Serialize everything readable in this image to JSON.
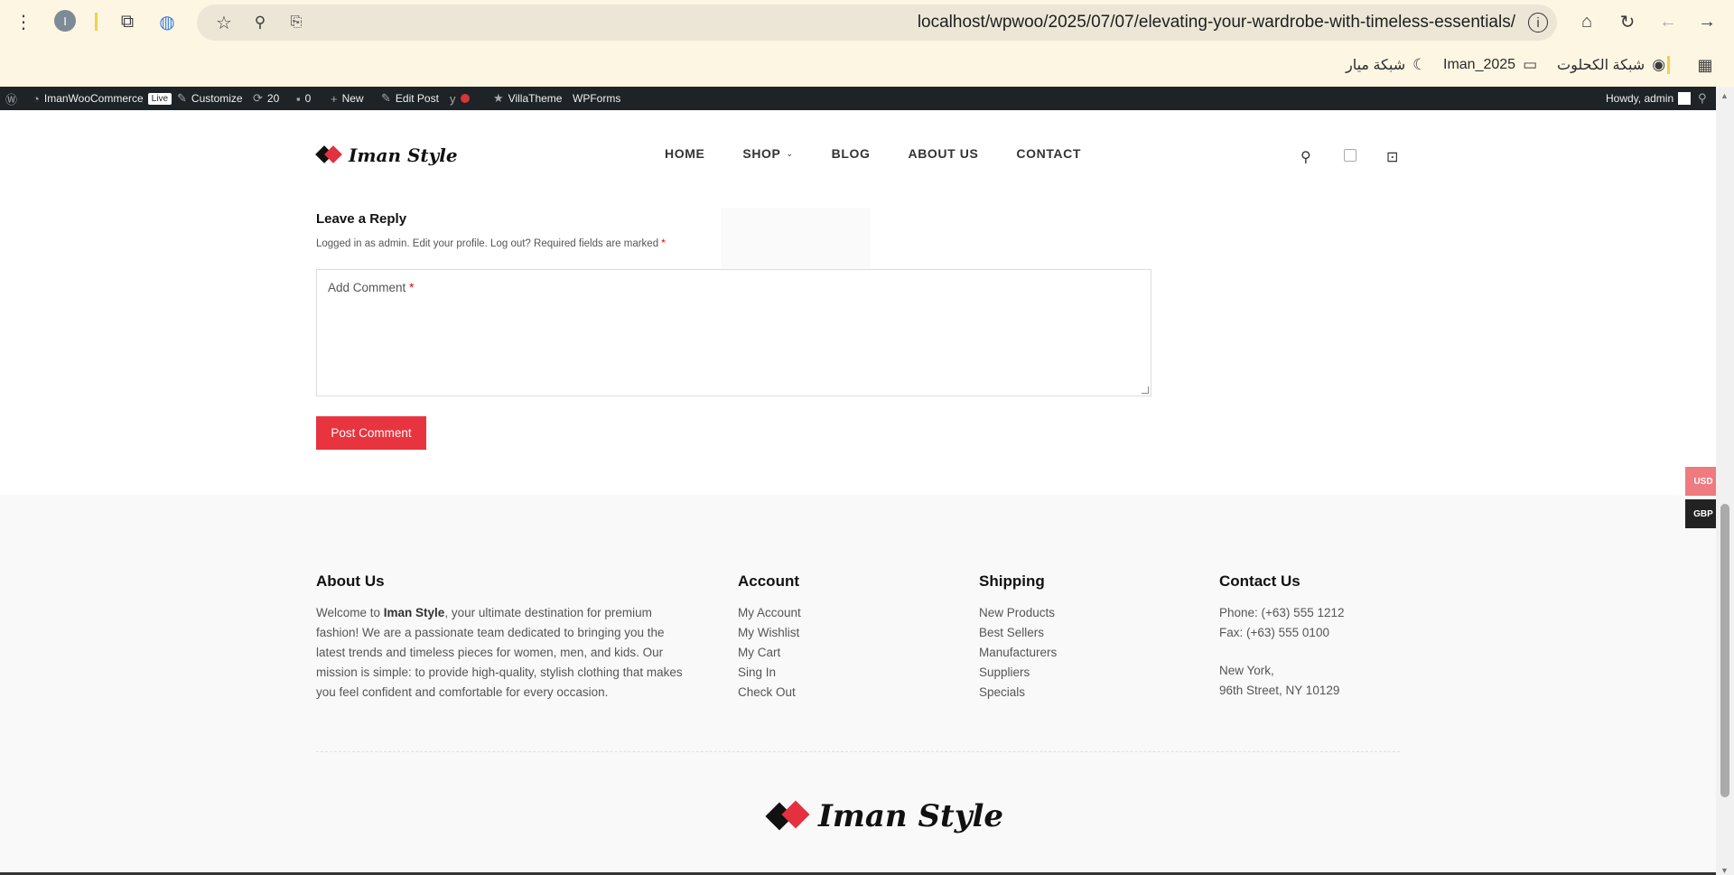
{
  "browser": {
    "profile_initial": "I",
    "url": "localhost/wpwoo/2025/07/07/elevating-your-wardrobe-with-timeless-essentials/",
    "bookmarks": [
      "شبكة الكحلوت",
      "Iman_2025",
      "شبكة ميار"
    ]
  },
  "adminbar": {
    "site": "ImanWooCommerce",
    "live": "Live",
    "customize": "Customize",
    "updates": "20",
    "comments": "0",
    "new": "New",
    "edit_post": "Edit Post",
    "villatheme": "VillaTheme",
    "wpforms": "WPForms",
    "howdy": "Howdy, admin"
  },
  "header": {
    "logo": "Iman Style",
    "nav": [
      "HOME",
      "SHOP",
      "BLOG",
      "ABOUT US",
      "CONTACT"
    ]
  },
  "reply": {
    "title": "Leave a Reply",
    "logged_in": "Logged in as admin. Edit your profile. Log out? Required fields are marked",
    "required_mark": "*",
    "comment_placeholder": "Add Comment",
    "post_button": "Post Comment"
  },
  "currency": {
    "usd": "USD",
    "gbp": "GBP"
  },
  "footer": {
    "about": {
      "title": "About Us",
      "text_before": "Welcome to ",
      "brand": "Iman Style",
      "text_after": ", your ultimate destination for premium fashion! We are a passionate team dedicated to bringing you the latest trends and timeless pieces for women, men, and kids. Our mission is simple: to provide high-quality, stylish clothing that makes you feel confident and comfortable for every occasion."
    },
    "account": {
      "title": "Account",
      "links": [
        "My Account",
        "My Wishlist",
        "My Cart",
        "Sing In",
        "Check Out"
      ]
    },
    "shipping": {
      "title": "Shipping",
      "links": [
        "New Products",
        "Best Sellers",
        "Manufacturers",
        "Suppliers",
        "Specials"
      ]
    },
    "contact": {
      "title": "Contact Us",
      "phone": "Phone: (+63) 555 1212",
      "fax": "Fax: (+63) 555 0100",
      "city": "New York,",
      "street": "96th Street, NY 10129"
    },
    "logo": "Iman Style"
  },
  "colors": {
    "accent": "#e8343f",
    "adminbar": "#1d2327",
    "browser_bg": "#fdf6e3"
  }
}
